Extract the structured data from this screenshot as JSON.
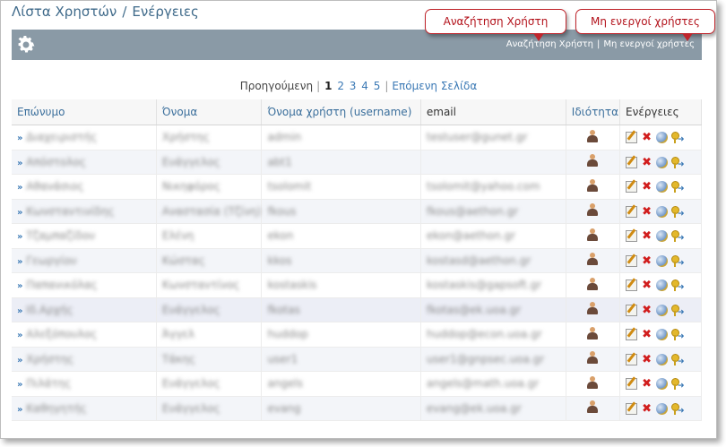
{
  "breadcrumb": {
    "section": "Λίστα Χρηστών",
    "separator": "/",
    "page": "Ενέργειες"
  },
  "toolbar": {
    "icon": "gear-icon",
    "link_search": "Αναζήτηση Χρήστη",
    "divider": "|",
    "link_inactive": "Μη ενεργοί χρήστες"
  },
  "callouts": {
    "search": "Αναζήτηση Χρήστη",
    "inactive": "Μη ενεργοί χρήστες"
  },
  "pagination": {
    "prev": "Προηγούμενη",
    "divider": "|",
    "current": "1",
    "pages": [
      "2",
      "3",
      "4",
      "5"
    ],
    "next": "Επόμενη Σελίδα"
  },
  "table": {
    "columns": [
      "Επώνυμο",
      "Όνομα",
      "Όνομα χρήστη (username)",
      "email",
      "Ιδιότητα",
      "Ενέργειες"
    ],
    "row_marker": "»",
    "rows": [
      {
        "surname": "Διαχειριστής",
        "name": "Χρήστης",
        "username": "admin",
        "email": "testuser@gunet.gr"
      },
      {
        "surname": "Απόστολος",
        "name": "Ευάγγελος",
        "username": "abt1",
        "email": ""
      },
      {
        "surname": "Αθανάσιος",
        "name": "Νικηφόρος",
        "username": "tsolomit",
        "email": "tsolomit@yahoo.com"
      },
      {
        "surname": "Κωνσταντινίδης",
        "name": "Αναστασία (Τζίνη)",
        "username": "fkous",
        "email": "fkous@aethon.gr"
      },
      {
        "surname": "Τζαμπαζίδου",
        "name": "Ελένη",
        "username": "ekon",
        "email": "ekon@aethon.gr"
      },
      {
        "surname": "Γεωργίου",
        "name": "Κώστας",
        "username": "kkos",
        "email": "kostasd@aethon.gr"
      },
      {
        "surname": "Παπανικόλας",
        "name": "Κωνσταντίνος",
        "username": "kostaskis",
        "email": "kostaskis@gapsoft.gr"
      },
      {
        "surname": "Ιδ.Αρχής",
        "name": "Ευάγγελος",
        "username": "fkotas",
        "email": "fkotas@ek.uoa.gr"
      },
      {
        "surname": "Αλεξόπουλος",
        "name": "Άγγελ",
        "username": "huddop",
        "email": "huddop@econ.uoa.gr"
      },
      {
        "surname": "Χρήστης",
        "name": "Τάκης",
        "username": "user1",
        "email": "user1@gnpsec.uoa.gr"
      },
      {
        "surname": "Πιλάτης",
        "name": "Ευάγγελος",
        "username": "angels",
        "email": "angels@math.uoa.gr"
      },
      {
        "surname": "Καθηγητής",
        "name": "Ευάγγελος",
        "username": "evang",
        "email": "evang@ek.uoa.gr"
      }
    ]
  },
  "colors": {
    "toolbar": "#8a9aa6",
    "link": "#3b79b5",
    "callout": "#c0262d"
  }
}
